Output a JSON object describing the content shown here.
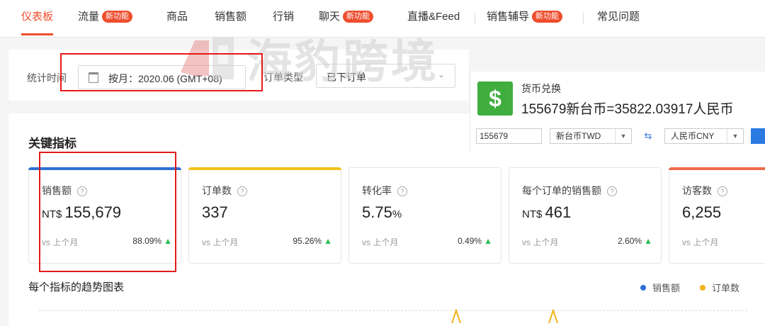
{
  "nav": {
    "tabs": [
      {
        "label": "仪表板",
        "active": true
      },
      {
        "label": "流量",
        "badge": "新功能"
      },
      {
        "label": "商品"
      },
      {
        "label": "销售额"
      },
      {
        "label": "行销"
      },
      {
        "label": "聊天",
        "badge": "新功能"
      },
      {
        "label": "直播&Feed"
      },
      {
        "label": "销售辅导",
        "badge": "新功能"
      },
      {
        "label": "常见问题"
      }
    ]
  },
  "watermark": {
    "text": "海豹跨境"
  },
  "filters": {
    "period_label": "统计时间",
    "period_value": "按月：2020.06 (GMT+08)",
    "order_type_label": "订单类型",
    "order_type_value": "已下订单"
  },
  "currency_converter": {
    "title": "货币兑换",
    "icon": "dollar-sign-icon",
    "result": "155679新台币=35822.03917人民币",
    "amount": "155679",
    "from_currency": "新台币TWD",
    "to_currency": "人民币CNY",
    "accent_color": "#3fae3f"
  },
  "key_metrics": {
    "title": "关键指标",
    "compare_label": "vs 上个月",
    "items": [
      {
        "name": "销售额",
        "prefix": "NT$ ",
        "value": "155,679",
        "unit": "",
        "change": "88.09%",
        "color": "#2f6fd6"
      },
      {
        "name": "订单数",
        "prefix": "",
        "value": "337",
        "unit": "",
        "change": "95.26%",
        "color": "#f2c21b"
      },
      {
        "name": "转化率",
        "prefix": "",
        "value": "5.75",
        "unit": "%",
        "change": "0.49%",
        "color": ""
      },
      {
        "name": "每个订单的销售额",
        "prefix": "NT$ ",
        "value": "461",
        "unit": "",
        "change": "2.60%",
        "color": ""
      },
      {
        "name": "访客数",
        "prefix": "",
        "value": "6,255",
        "unit": "",
        "change": "",
        "color": "#ee6a4a"
      }
    ]
  },
  "trend": {
    "title": "每个指标的趋势图表",
    "legend": [
      {
        "label": "销售额",
        "color": "#2f6fd6"
      },
      {
        "label": "订单数",
        "color": "#f2b21b"
      }
    ]
  }
}
